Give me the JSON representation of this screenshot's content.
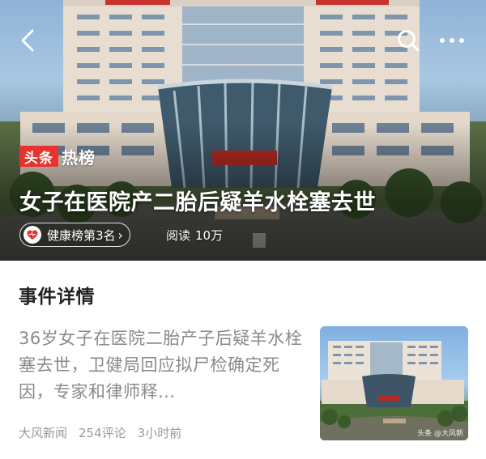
{
  "hero": {
    "brand_tag": "头条",
    "brand_text": "热榜",
    "title": "女子在医院产二胎后疑羊水栓塞去世",
    "rank_label": "健康榜第3名",
    "reads_label": "阅读",
    "reads_count": "10万",
    "accent_color": "#e8322d"
  },
  "icons": {
    "back": "back-arrow-icon",
    "search": "search-icon",
    "more": "more-icon",
    "rank": "heart-icon"
  },
  "section": {
    "title": "事件详情"
  },
  "card": {
    "text": "36岁女子在医院二胎产子后疑羊水栓塞去世，卫健局回应拟尸检确定死因，专家和律师释…",
    "source": "大风新闻",
    "comments": "254评论",
    "time": "3小时前",
    "thumb_watermark": "头条 @大风新"
  }
}
